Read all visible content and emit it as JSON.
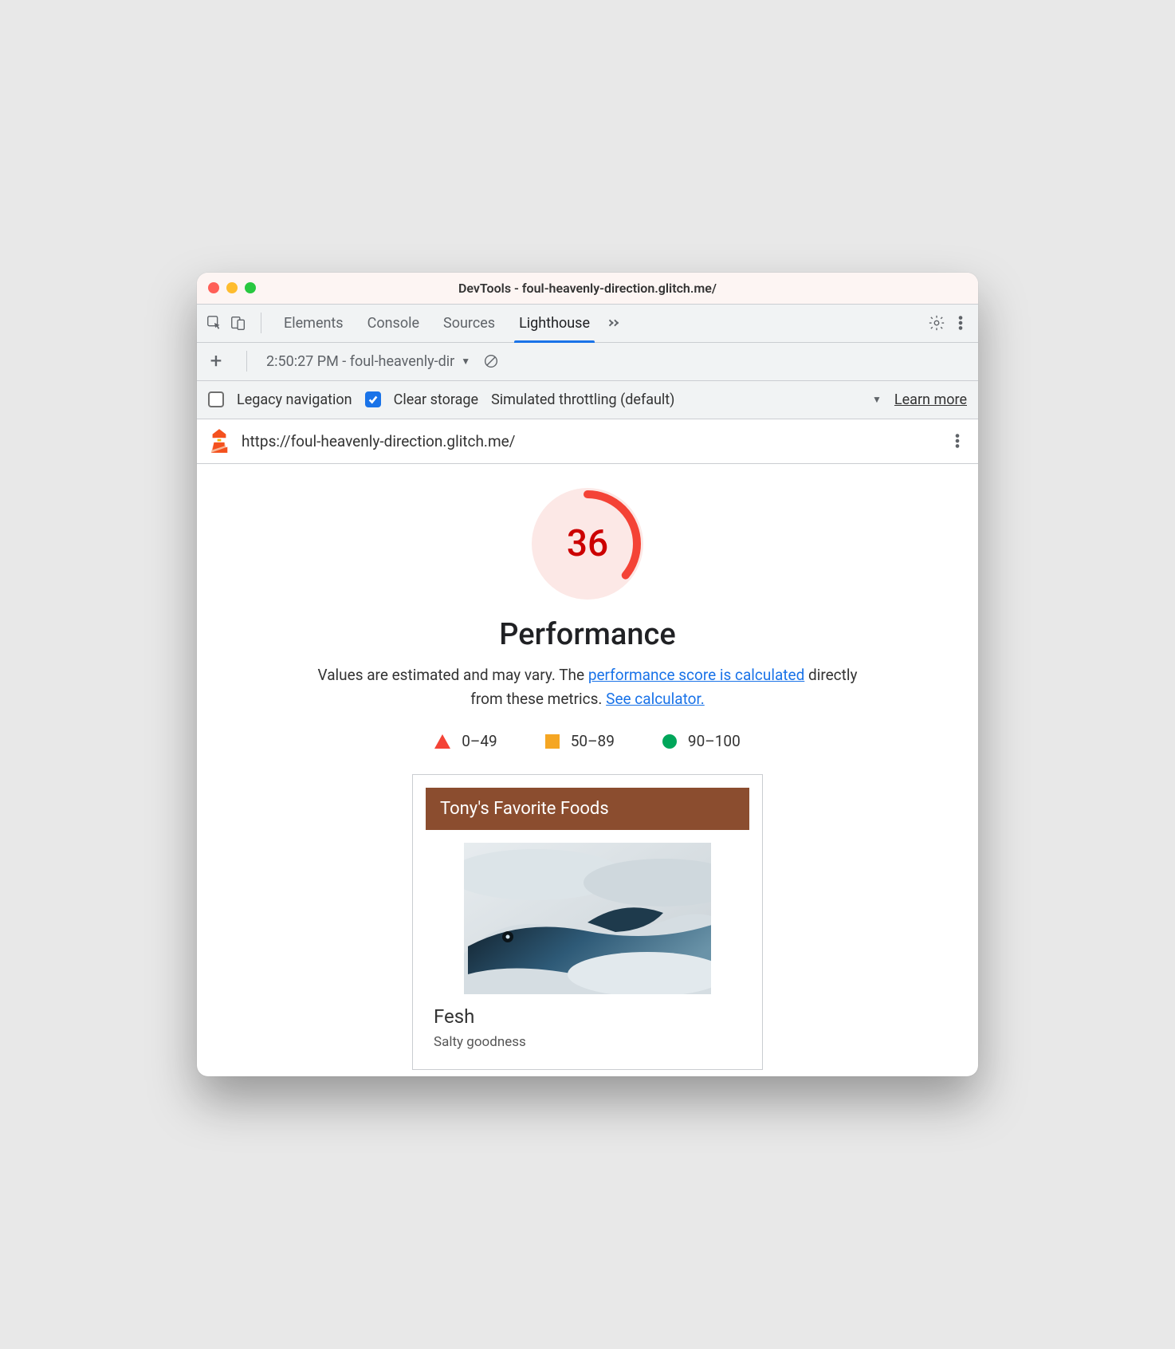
{
  "window": {
    "title": "DevTools - foul-heavenly-direction.glitch.me/"
  },
  "tabs": {
    "items": [
      "Elements",
      "Console",
      "Sources",
      "Lighthouse"
    ],
    "active": "Lighthouse"
  },
  "secondbar": {
    "report_label": "2:50:27 PM - foul-heavenly-dir"
  },
  "options": {
    "legacy_label": "Legacy navigation",
    "legacy_checked": false,
    "clear_label": "Clear storage",
    "clear_checked": true,
    "throttling_label": "Simulated throttling (default)",
    "learn_more": "Learn more"
  },
  "urlbar": {
    "url": "https://foul-heavenly-direction.glitch.me/"
  },
  "report": {
    "score": "36",
    "score_percent": 36,
    "title": "Performance",
    "desc_pre": "Values are estimated and may vary. The ",
    "desc_link1": "performance score is calculated",
    "desc_mid": " directly from these metrics. ",
    "desc_link2": "See calculator.",
    "legend": {
      "low": "0–49",
      "mid": "50–89",
      "high": "90–100"
    }
  },
  "preview": {
    "heading": "Tony's Favorite Foods",
    "item_title": "Fesh",
    "item_sub": "Salty goodness"
  }
}
